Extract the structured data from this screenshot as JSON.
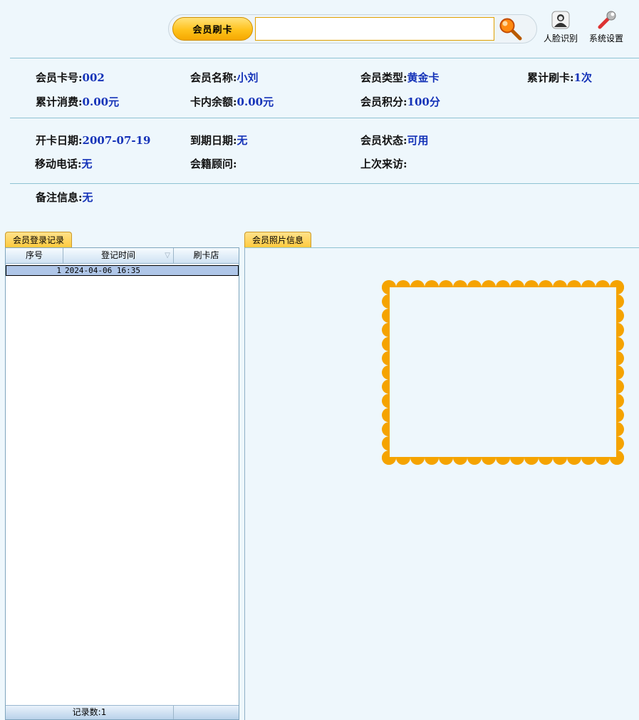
{
  "topbar": {
    "swipe_button": "会员刷卡",
    "card_input_value": "",
    "search_icon": "search-magnifier-icon",
    "tools": [
      {
        "label": "人脸识别",
        "icon": "face-id-icon"
      },
      {
        "label": "系统设置",
        "icon": "wrench-settings-icon"
      }
    ]
  },
  "member": {
    "card_no": {
      "label": "会员卡号:",
      "value": "002"
    },
    "name": {
      "label": "会员名称:",
      "value": "小刘"
    },
    "type": {
      "label": "会员类型:",
      "value": "黄金卡"
    },
    "swipe_count": {
      "label": "累计刷卡:",
      "value": "1次"
    },
    "total_spend": {
      "label": "累计消费:",
      "value": "0.00元"
    },
    "balance": {
      "label": "卡内余额:",
      "value": "0.00元"
    },
    "points": {
      "label": "会员积分:",
      "value": "100分"
    },
    "open_date": {
      "label": "开卡日期:",
      "value": "2007-07-19"
    },
    "expire_date": {
      "label": "到期日期:",
      "value": "无"
    },
    "status": {
      "label": "会员状态:",
      "value": "可用"
    },
    "mobile": {
      "label": "移动电话:",
      "value": "无"
    },
    "advisor": {
      "label": "会籍顾问:",
      "value": ""
    },
    "last_visit": {
      "label": "上次来访:",
      "value": ""
    },
    "remark": {
      "label": "备注信息:",
      "value": "无"
    }
  },
  "login_records": {
    "tab": "会员登录记录",
    "columns": [
      "序号",
      "登记时间",
      "刷卡店"
    ],
    "rows": [
      {
        "no": "1",
        "time": "2024-04-06 16:35",
        "store": ""
      }
    ],
    "footer": "记录数:1"
  },
  "photo": {
    "tab": "会员照片信息"
  },
  "colors": {
    "accent": "#ffc21c",
    "value_text": "#1533b8",
    "frame": "#f5a300",
    "background": "#eef7fc"
  }
}
